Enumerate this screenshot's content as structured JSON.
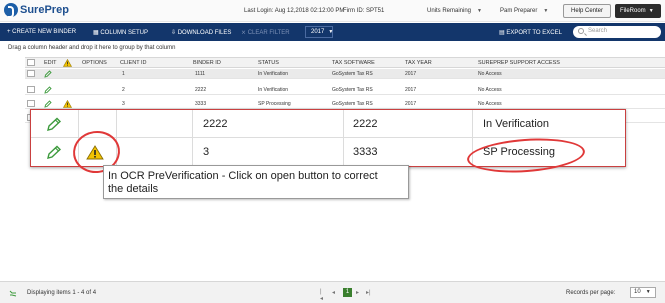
{
  "header": {
    "logo_text": "SurePrep",
    "last_login": "Last Login: Aug 12,2018 02:12:00 PM",
    "firm_id": "Firm ID: SPT51",
    "units_dropdown": "Units Remaining",
    "user_dropdown": "Pam Preparer",
    "help_label": "Help Center",
    "fileroom_label": "FileRoom"
  },
  "toolbar": {
    "create_binder": "+ CREATE NEW BINDER",
    "column_setup": "COLUMN SETUP",
    "download_files": "DOWNLOAD FILES",
    "clear_filter": "CLEAR FILTER",
    "year": "2017",
    "export_excel": "EXPORT TO EXCEL",
    "search_placeholder": "Search"
  },
  "group_hint": "Drag a column header and drop it here to group by that column",
  "columns": {
    "edit": "EDIT",
    "options": "OPTIONS",
    "client_id": "CLIENT ID",
    "binder_id": "BINDER ID",
    "status": "STATUS",
    "tax_software": "TAX SOFTWARE",
    "tax_year": "TAX YEAR",
    "support_access": "SUREPREP SUPPORT ACCESS"
  },
  "rows": [
    {
      "client_id": "1",
      "binder_id": "1111",
      "status": "In Verification",
      "tax_software": "GoSystem Tax RS",
      "tax_year": "2017",
      "support_access": "No Access",
      "warning": false
    },
    {
      "client_id": "2",
      "binder_id": "2222",
      "status": "In Verification",
      "tax_software": "GoSystem Tax RS",
      "tax_year": "2017",
      "support_access": "No Access",
      "warning": false
    },
    {
      "client_id": "3",
      "binder_id": "3333",
      "status": "SP Processing",
      "tax_software": "GoSystem Tax RS",
      "tax_year": "2017",
      "support_access": "No Access",
      "warning": true
    }
  ],
  "zoom_rows": [
    {
      "client_id": "2",
      "binder_id": "2222",
      "status": "In Verification"
    },
    {
      "client_id": "3",
      "binder_id": "3333",
      "status": "SP Processing"
    }
  ],
  "tooltip": {
    "line1": "In OCR PreVerification - Click on open button to correct",
    "line2": "the details"
  },
  "status_bar": {
    "displaying": "Displaying items 1 - 4 of 4",
    "current_page": "1",
    "records_per_page_label": "Records per page:",
    "records_per_page": "10"
  },
  "colors": {
    "toolbar_bg": "#13366b",
    "logo_blue": "#1d5fa8",
    "pencil_green": "#3c9a3c",
    "warning_yellow": "#f2c200",
    "annotation_red": "#e03838",
    "pager_green": "#3a7f2e"
  }
}
